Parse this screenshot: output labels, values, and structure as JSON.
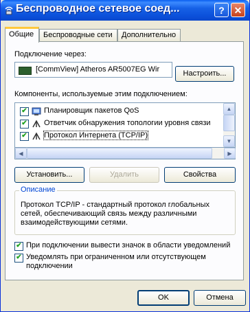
{
  "window": {
    "title": "Беспроводное сетевое соед...",
    "help_label": "?",
    "close_label": "✕"
  },
  "tabs": [
    {
      "label": "Общие",
      "active": true
    },
    {
      "label": "Беспроводные сети",
      "active": false
    },
    {
      "label": "Дополнительно",
      "active": false
    }
  ],
  "general": {
    "connect_using_label": "Подключение через:",
    "adapter_name": "[CommView] Atheros AR5007EG Wir",
    "configure_label": "Настроить...",
    "components_label": "Компоненты, используемые этим подключением:",
    "components": [
      {
        "label": "Планировщик пакетов QoS",
        "checked": true,
        "icon": "qos-scheduler-icon"
      },
      {
        "label": "Ответчик обнаружения топологии уровня связи",
        "checked": true,
        "icon": "network-protocol-icon"
      },
      {
        "label": "Протокол Интернета (TCP/IP)",
        "checked": true,
        "icon": "network-protocol-icon",
        "selected": true
      }
    ],
    "install_label": "Установить...",
    "uninstall_label": "Удалить",
    "properties_label": "Свойства",
    "description_title": "Описание",
    "description_text": "Протокол TCP/IP - стандартный протокол глобальных сетей, обеспечивающий связь между различными взаимодействующими сетями.",
    "show_icon_label": "При подключении вывести значок в области уведомлений",
    "show_icon_checked": true,
    "notify_label": "Уведомлять при ограниченном или отсутствующем подключении",
    "notify_checked": true
  },
  "footer": {
    "ok_label": "OK",
    "cancel_label": "Отмена"
  },
  "colors": {
    "titlebar": "#0b4fd9",
    "dialog_bg": "#ece9d8",
    "panel_bg": "#fcfcfe",
    "group_title": "#0046d5",
    "checkmark": "#21a121"
  }
}
